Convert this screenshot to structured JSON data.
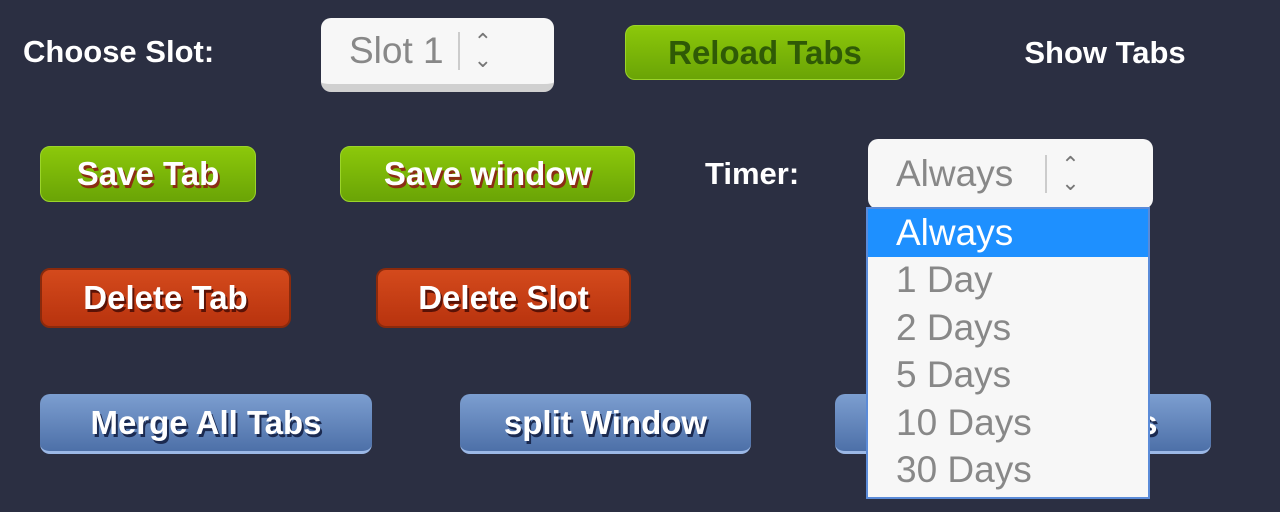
{
  "slot": {
    "label": "Choose Slot:",
    "value": "Slot 1"
  },
  "buttons": {
    "reload": "Reload Tabs",
    "show": "Show Tabs",
    "save_tab": "Save Tab",
    "save_window": "Save window",
    "delete_tab": "Delete Tab",
    "delete_slot": "Delete Slot",
    "merge": "Merge All Tabs",
    "split": "split Window",
    "third": "Alphabetize Tabs"
  },
  "timer": {
    "label": "Timer:",
    "value": "Always",
    "options": [
      "Always",
      "1 Day",
      "2 Days",
      "5 Days",
      "10 Days",
      "30 Days"
    ],
    "highlighted": "Always"
  },
  "colors": {
    "background": "#2b2f42",
    "green": "#7ab808",
    "red": "#c63e14",
    "blue": "#6688c0",
    "highlight": "#1e90ff"
  }
}
